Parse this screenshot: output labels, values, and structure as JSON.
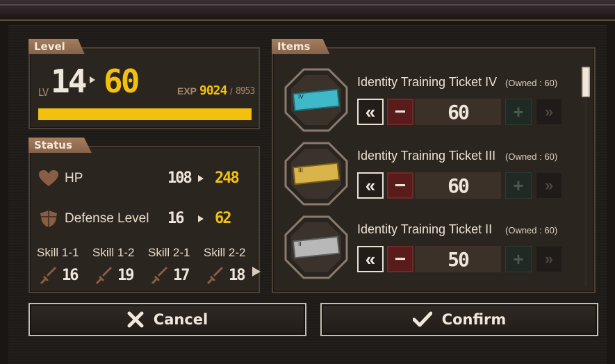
{
  "panels": {
    "level_title": "Level",
    "status_title": "Status",
    "items_title": "Items"
  },
  "level": {
    "lv_tag": "LV",
    "from": "14",
    "to": "60",
    "exp_label": "EXP",
    "exp_current": "9024",
    "exp_separator": "/",
    "exp_max": "8953",
    "exp_fill_fraction": 1.0
  },
  "status": {
    "hp": {
      "label": "HP",
      "from": "108",
      "to": "248",
      "icon": "heart-icon"
    },
    "defense": {
      "label": "Defense Level",
      "from": "16",
      "to": "62",
      "icon": "shield-icon"
    },
    "skills": [
      {
        "name": "Skill 1-1",
        "value": "16",
        "icon": "sword-icon"
      },
      {
        "name": "Skill 1-2",
        "value": "19",
        "icon": "sword-icon"
      },
      {
        "name": "Skill 2-1",
        "value": "17",
        "icon": "sword-icon"
      },
      {
        "name": "Skill 2-2",
        "value": "18",
        "icon": "sword-icon"
      }
    ]
  },
  "items": [
    {
      "name": "Identity Training Ticket IV",
      "owned": "(Owned : 60)",
      "quantity": "60",
      "tier_label": "IV",
      "ticket_color": "#3fb9c9"
    },
    {
      "name": "Identity Training Ticket III",
      "owned": "(Owned : 60)",
      "quantity": "60",
      "tier_label": "III",
      "ticket_color": "#d8b44a"
    },
    {
      "name": "Identity Training Ticket II",
      "owned": "(Owned : 60)",
      "quantity": "50",
      "tier_label": "II",
      "ticket_color": "#b8b8b8"
    }
  ],
  "controls": {
    "min_symbol": "«",
    "dec_symbol": "−",
    "inc_symbol": "+",
    "max_symbol": "»"
  },
  "buttons": {
    "cancel": "Cancel",
    "confirm": "Confirm"
  },
  "colors": {
    "accent_gold": "#f2c00f",
    "panel_tab": "#a47e5d",
    "decrease_red": "#5a1c1a"
  }
}
